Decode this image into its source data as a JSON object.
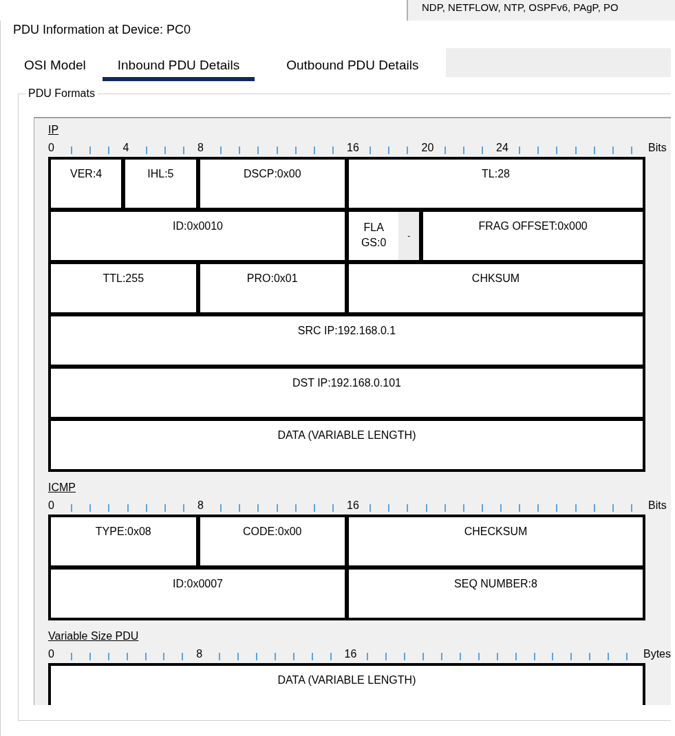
{
  "background_window": {
    "text": "NDP, NETFLOW, NTP, OSPFv6, PAgP, PO"
  },
  "window": {
    "title": "PDU Information at Device: PC0"
  },
  "tabs": [
    {
      "label": "OSI Model",
      "selected": false
    },
    {
      "label": "Inbound PDU Details",
      "selected": true
    },
    {
      "label": "Outbound PDU Details",
      "selected": false
    }
  ],
  "group": {
    "title": "PDU Formats"
  },
  "sections": [
    {
      "title": "IP",
      "ruler": [
        "0",
        "4",
        "8",
        "16",
        "20",
        "24"
      ],
      "unit": "Bits",
      "rows": [
        [
          {
            "text": "VER:4",
            "colspan": 4
          },
          {
            "text": "IHL:5",
            "colspan": 4
          },
          {
            "text": "DSCP:0x00",
            "colspan": 8
          },
          {
            "text": "TL:28",
            "colspan": 16
          }
        ],
        [
          {
            "text": "ID:0x0010",
            "colspan": 16
          },
          {
            "text": "FLAGS:0",
            "kind": "split",
            "extra": "-",
            "colspan": 4
          },
          {
            "text": "FRAG OFFSET:0x000",
            "colspan": 12
          }
        ],
        [
          {
            "text": "TTL:255",
            "colspan": 8
          },
          {
            "text": "PRO:0x01",
            "colspan": 8
          },
          {
            "text": "CHKSUM",
            "colspan": 16
          }
        ],
        [
          {
            "text": "SRC IP:192.168.0.1",
            "colspan": 32
          }
        ],
        [
          {
            "text": "DST IP:192.168.0.101",
            "colspan": 32
          }
        ],
        [
          {
            "text": "DATA (VARIABLE LENGTH)",
            "colspan": 32
          }
        ]
      ]
    },
    {
      "title": "ICMP",
      "ruler": [
        "0",
        "8",
        "16"
      ],
      "unit": "Bits",
      "rows": [
        [
          {
            "text": "TYPE:0x08",
            "colspan": 8
          },
          {
            "text": "CODE:0x00",
            "colspan": 8
          },
          {
            "text": "CHECKSUM",
            "colspan": 16
          }
        ],
        [
          {
            "text": "ID:0x0007",
            "colspan": 16
          },
          {
            "text": "SEQ NUMBER:8",
            "colspan": 16
          }
        ]
      ]
    },
    {
      "title": "Variable Size PDU",
      "ruler": [
        "0",
        "8",
        "16"
      ],
      "unit": "Bytes",
      "rows": [
        [
          {
            "text": "DATA (VARIABLE LENGTH)",
            "colspan": 32
          }
        ]
      ]
    }
  ]
}
